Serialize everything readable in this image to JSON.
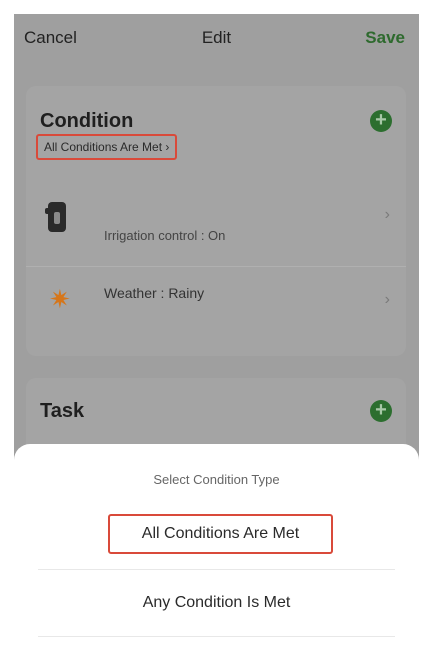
{
  "nav": {
    "cancel": "Cancel",
    "title": "Edit",
    "save": "Save"
  },
  "condition": {
    "title": "Condition",
    "type_pill": "All Conditions Are Met ›",
    "items": [
      {
        "label": "Irrigation control : On",
        "icon": "irrigation-device-icon"
      },
      {
        "label": "Weather : Rainy",
        "icon": "sun-icon"
      }
    ]
  },
  "task": {
    "title": "Task"
  },
  "sheet": {
    "title": "Select Condition Type",
    "options": [
      "All Conditions Are Met",
      "Any Condition Is Met"
    ]
  },
  "colors": {
    "accent_green": "#2e6a2e",
    "highlight_red": "#d94a3a",
    "sun_orange": "#d6761a"
  }
}
